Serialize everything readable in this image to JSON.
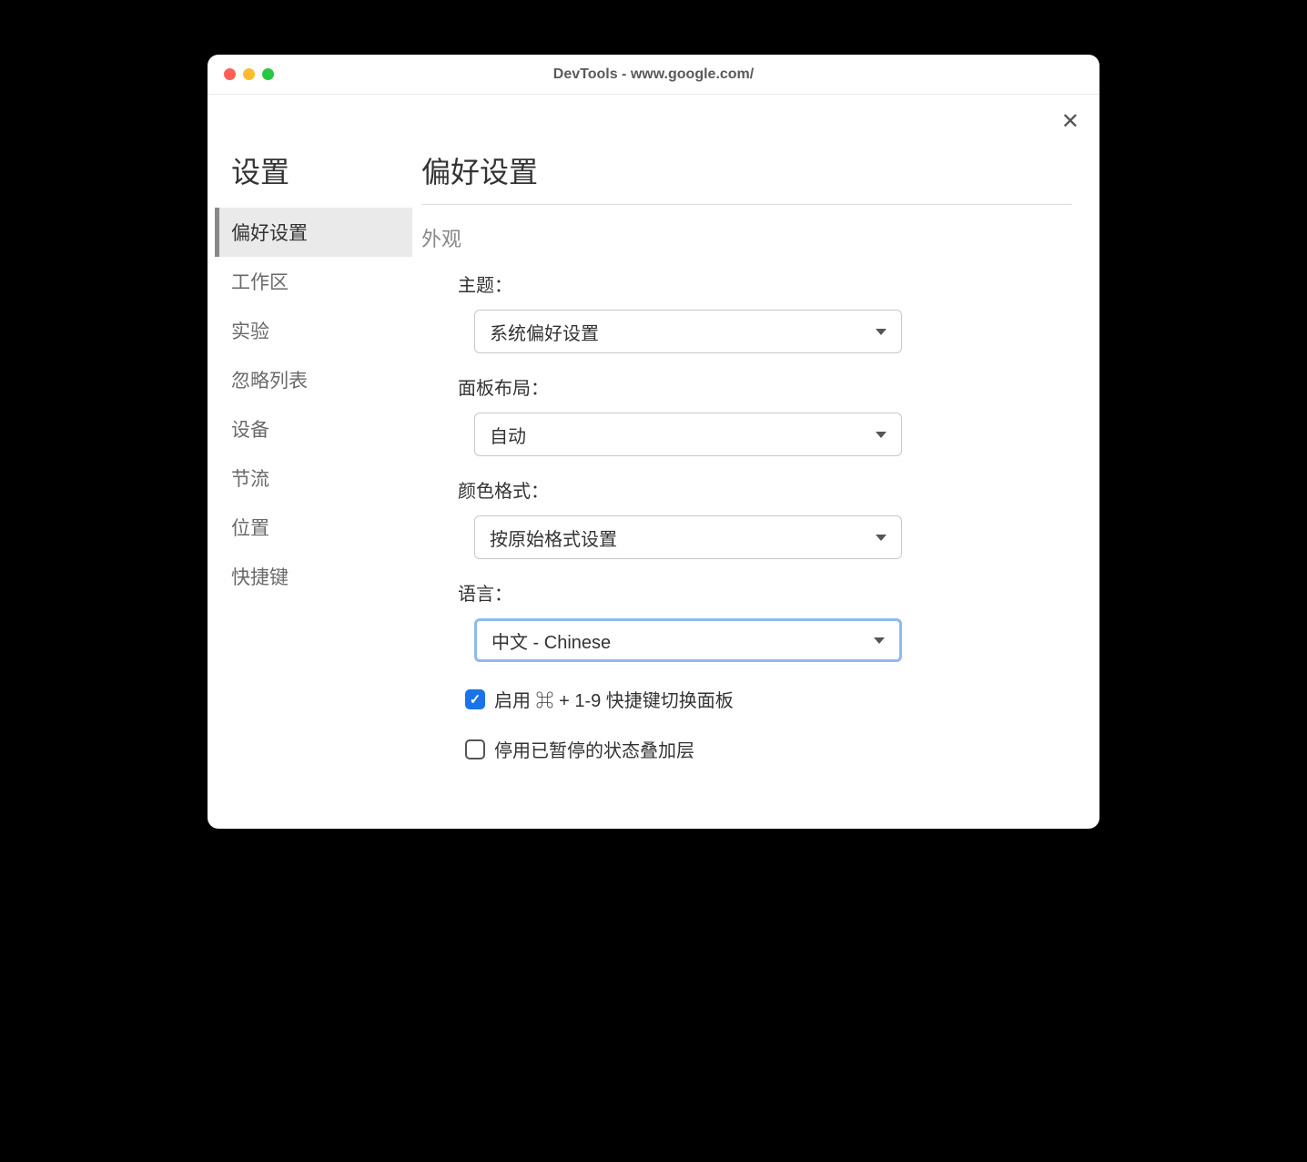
{
  "window": {
    "title": "DevTools - www.google.com/"
  },
  "sidebar": {
    "title": "设置",
    "items": [
      {
        "label": "偏好设置",
        "active": true
      },
      {
        "label": "工作区",
        "active": false
      },
      {
        "label": "实验",
        "active": false
      },
      {
        "label": "忽略列表",
        "active": false
      },
      {
        "label": "设备",
        "active": false
      },
      {
        "label": "节流",
        "active": false
      },
      {
        "label": "位置",
        "active": false
      },
      {
        "label": "快捷键",
        "active": false
      }
    ]
  },
  "content": {
    "title": "偏好设置",
    "section": "外观",
    "fields": {
      "theme": {
        "label": "主题：",
        "value": "系统偏好设置"
      },
      "layout": {
        "label": "面板布局：",
        "value": "自动"
      },
      "colorFormat": {
        "label": "颜色格式：",
        "value": "按原始格式设置"
      },
      "language": {
        "label": "语言：",
        "value": "中文 - Chinese"
      }
    },
    "checkboxes": {
      "enableShortcut": {
        "checked": true,
        "label": "启用 ⌘ + 1-9 快捷键切换面板"
      },
      "disableOverlay": {
        "checked": false,
        "label": "停用已暂停的状态叠加层"
      }
    }
  }
}
